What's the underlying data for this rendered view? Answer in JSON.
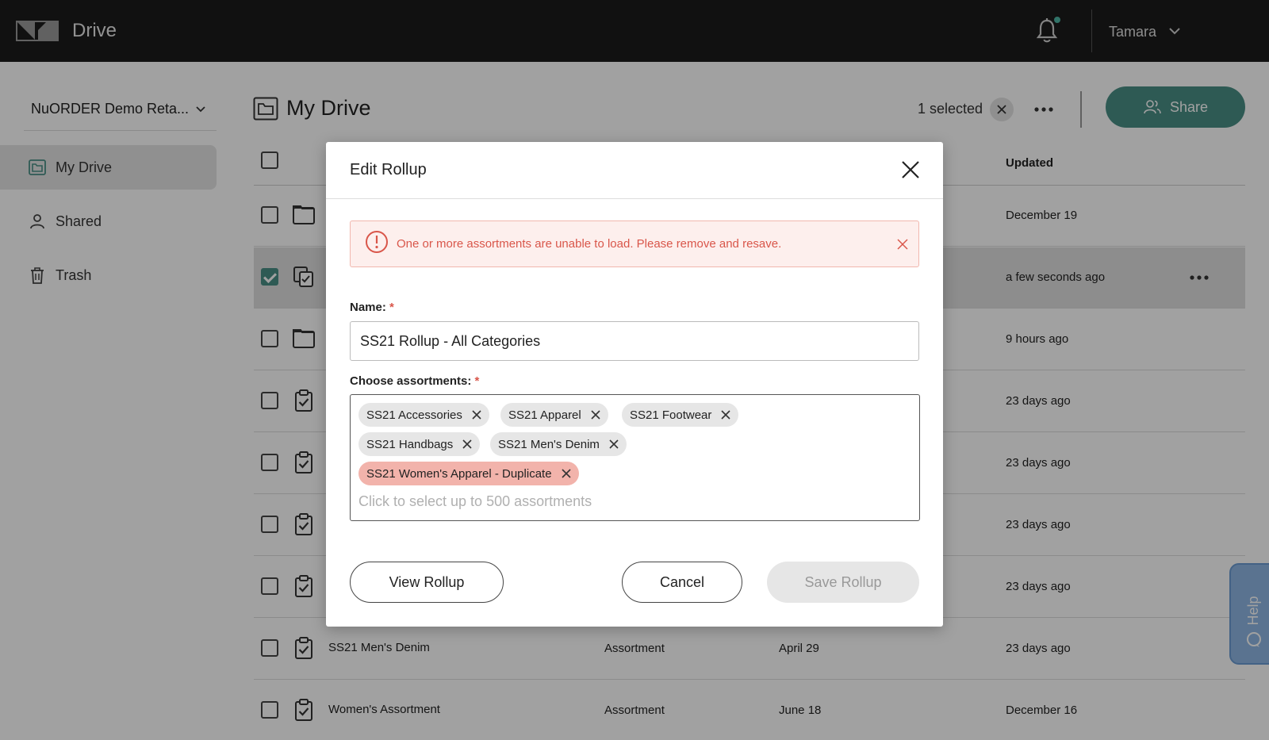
{
  "app": {
    "name": "Drive",
    "user": "Tamara"
  },
  "sidebar": {
    "org": "NuORDER Demo Reta...",
    "items": [
      {
        "label": "My Drive",
        "icon": "folder-icon",
        "active": true
      },
      {
        "label": "Shared",
        "icon": "person-icon",
        "active": false
      },
      {
        "label": "Trash",
        "icon": "trash-icon",
        "active": false
      }
    ]
  },
  "main": {
    "title": "My Drive",
    "selected_count": "1 selected",
    "share_label": "Share",
    "columns": {
      "updated": "Updated"
    },
    "rows": [
      {
        "name": "",
        "type": "",
        "date": "",
        "updated": "December 19",
        "icon": "folder-icon",
        "checked": false
      },
      {
        "name": "",
        "type": "",
        "date": "",
        "updated": "a few seconds ago",
        "icon": "rollup-icon",
        "checked": true
      },
      {
        "name": "",
        "type": "",
        "date": "",
        "updated": "9 hours ago",
        "icon": "folder-icon",
        "checked": false
      },
      {
        "name": "",
        "type": "",
        "date": "",
        "updated": "23 days ago",
        "icon": "clipboard-check-icon",
        "checked": false
      },
      {
        "name": "",
        "type": "",
        "date": "",
        "updated": "23 days ago",
        "icon": "clipboard-check-icon",
        "checked": false
      },
      {
        "name": "",
        "type": "",
        "date": "",
        "updated": "23 days ago",
        "icon": "clipboard-check-icon",
        "checked": false
      },
      {
        "name": "",
        "type": "",
        "date": "",
        "updated": "23 days ago",
        "icon": "clipboard-check-icon",
        "checked": false
      },
      {
        "name": "SS21 Men's Denim",
        "type": "Assortment",
        "date": "April 29",
        "updated": "23 days ago",
        "icon": "clipboard-check-icon",
        "checked": false
      },
      {
        "name": "Women's Assortment",
        "type": "Assortment",
        "date": "June 18",
        "updated": "December 16",
        "icon": "clipboard-check-icon",
        "checked": false
      }
    ]
  },
  "help": {
    "label": "Help"
  },
  "modal": {
    "title": "Edit Rollup",
    "alert": "One or more assortments are unable to load. Please remove and resave.",
    "name_label": "Name:",
    "name_value": "SS21 Rollup - All Categories",
    "assort_label": "Choose assortments:",
    "required_mark": "*",
    "chips": [
      {
        "label": "SS21 Accessories",
        "error": false
      },
      {
        "label": "SS21 Apparel",
        "error": false
      },
      {
        "label": "SS21 Footwear",
        "error": false
      },
      {
        "label": "SS21 Handbags",
        "error": false
      },
      {
        "label": "SS21 Men's Denim",
        "error": false
      },
      {
        "label": "SS21 Women's Apparel - Duplicate",
        "error": true
      }
    ],
    "assort_placeholder": "Click to select up to 500 assortments",
    "view_label": "View Rollup",
    "cancel_label": "Cancel",
    "save_label": "Save Rollup"
  },
  "colors": {
    "accent": "#4a8f86",
    "error": "#d9564a",
    "notification_dot": "#4fb7a5",
    "help_tab": "#8fb7e4"
  }
}
